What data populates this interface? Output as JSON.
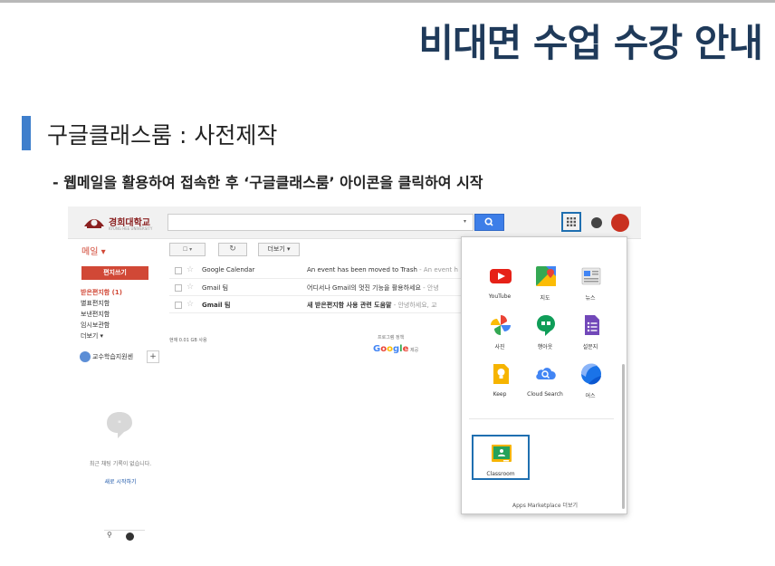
{
  "slide": {
    "title": "비대면 수업 수강 안내",
    "section": "구글클래스룸 : 사전제작",
    "subtitle": "- 웹메일을 활용하여 접속한 후 ‘구글클래스룸’ 아이콘을 클릭하여 시작"
  },
  "gmail": {
    "logo": {
      "name": "경희대학교",
      "sub": "KYUNG HEE UNIVERSITY"
    },
    "search": {
      "value": "",
      "caret": "▾"
    },
    "mail_label": "메일 ▾",
    "toolbar": {
      "checkbox": "☐ ▾",
      "refresh": "↻",
      "more": "더보기 ▾"
    },
    "compose": "편지쓰기",
    "nav": [
      "받은편지함 (1)",
      "별표편지함",
      "보낸편지함",
      "임시보관함",
      "더보기 ▾"
    ],
    "hangout_user": "교수학습지원센",
    "hangout_add": "+",
    "chat_empty": "최근 채팅 기록이 없습니다.",
    "chat_start": "새로 시작하기",
    "sidebar_bottom_person": "⚲",
    "rows": [
      {
        "from": "Google Calendar",
        "subject": "An event has been moved to Trash",
        "snippet": " - An event h",
        "unread": false
      },
      {
        "from": "Gmail 팀",
        "subject": "어디서나 Gmail의 멋진 기능을 활용하세요",
        "snippet": " - 안녕",
        "unread": false
      },
      {
        "from": "Gmail 팀",
        "subject": "새 받은편지함 사용 관련 도움말",
        "snippet": " - 안녕하세요, 교",
        "unread": true
      }
    ],
    "usage": "현재 0.01 GB 사용",
    "footer_terms": "프로그램 정책",
    "footer_google": "Google",
    "footer_google_tail": "제공",
    "colors": {
      "compose": "#d14836",
      "search_button": "#3d7ee8",
      "highlight": "#1f6fb0"
    }
  },
  "apps_menu": {
    "items": [
      {
        "label": "YouTube",
        "icon": "youtube-icon"
      },
      {
        "label": "지도",
        "icon": "maps-icon"
      },
      {
        "label": "뉴스",
        "icon": "news-icon"
      },
      {
        "label": "사진",
        "icon": "photos-icon"
      },
      {
        "label": "행아웃",
        "icon": "hangouts-icon"
      },
      {
        "label": "설문지",
        "icon": "forms-icon"
      },
      {
        "label": "Keep",
        "icon": "keep-icon"
      },
      {
        "label": "Cloud Search",
        "icon": "cloud-search-icon"
      },
      {
        "label": "어스",
        "icon": "earth-icon"
      },
      {
        "label": "Classroom",
        "icon": "classroom-icon"
      }
    ],
    "more_link": "Apps Marketplace 더보기"
  }
}
